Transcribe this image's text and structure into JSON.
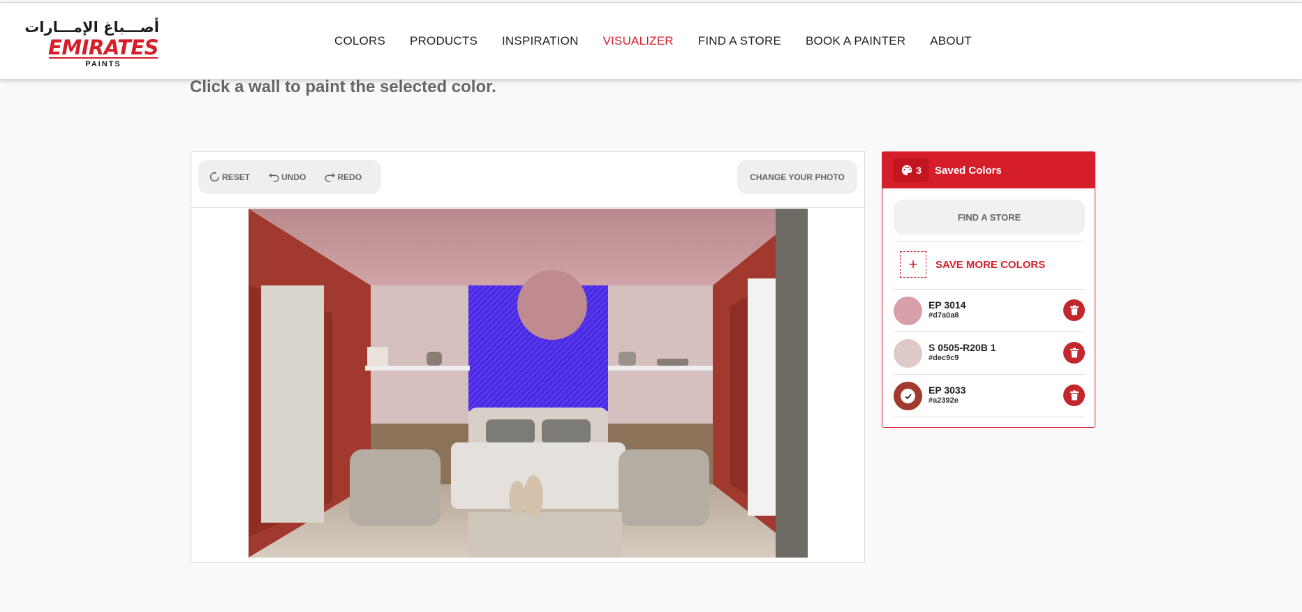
{
  "brand": {
    "arabic_name": "أصـــباغ الإمـــارات",
    "name": "EMIRATES",
    "sub": "PAINTS"
  },
  "nav": [
    {
      "label": "COLORS",
      "active": false
    },
    {
      "label": "PRODUCTS",
      "active": false
    },
    {
      "label": "INSPIRATION",
      "active": false
    },
    {
      "label": "VISUALIZER",
      "active": true
    },
    {
      "label": "FIND A STORE",
      "active": false
    },
    {
      "label": "BOOK A PAINTER",
      "active": false
    },
    {
      "label": "ABOUT",
      "active": false
    }
  ],
  "instruction": "Click a wall to paint the selected color.",
  "toolbar": {
    "reset": "RESET",
    "undo": "UNDO",
    "redo": "REDO",
    "change_photo": "CHANGE YOUR PHOTO"
  },
  "saved_colors": {
    "count": "3",
    "title": "Saved Colors",
    "find_store": "FIND A STORE",
    "save_more": "SAVE MORE COLORS",
    "items": [
      {
        "name": "EP 3014",
        "hex": "#d7a0a8",
        "selected": false
      },
      {
        "name": "S 0505-R20B 1",
        "hex": "#dec9c9",
        "selected": false
      },
      {
        "name": "EP 3033",
        "hex": "#a2392e",
        "selected": true
      }
    ]
  },
  "colors": {
    "brand_red": "#d51e2a",
    "wall_highlight": "#4b2ae6"
  }
}
